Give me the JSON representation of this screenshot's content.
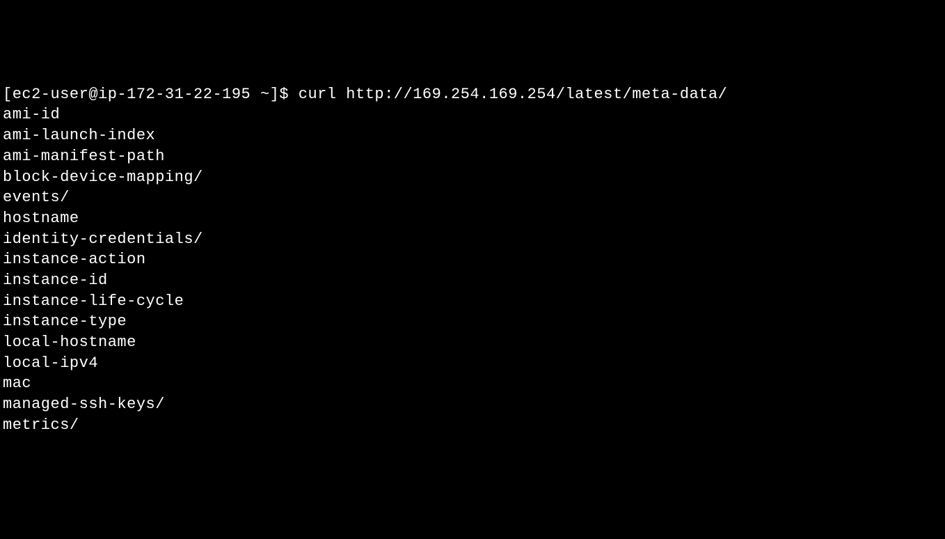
{
  "terminal": {
    "prompt": "[ec2-user@ip-172-31-22-195 ~]$ ",
    "command": "curl http://169.254.169.254/latest/meta-data/",
    "output": [
      "ami-id",
      "ami-launch-index",
      "ami-manifest-path",
      "block-device-mapping/",
      "events/",
      "hostname",
      "identity-credentials/",
      "instance-action",
      "instance-id",
      "instance-life-cycle",
      "instance-type",
      "local-hostname",
      "local-ipv4",
      "mac",
      "managed-ssh-keys/",
      "metrics/"
    ]
  }
}
